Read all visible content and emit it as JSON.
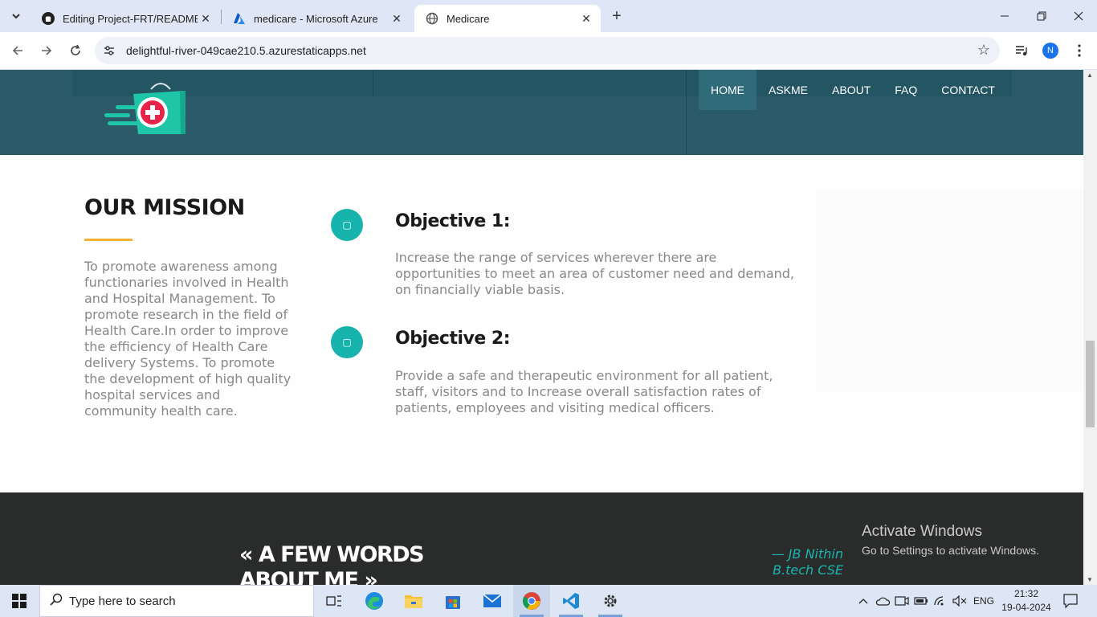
{
  "browser": {
    "tabs": [
      {
        "title": "Editing Project-FRT/README.m",
        "icon": "github-icon",
        "close": "✕"
      },
      {
        "title": "medicare - Microsoft Azure",
        "icon": "azure-icon",
        "close": "✕"
      },
      {
        "title": "Medicare",
        "icon": "globe-icon",
        "close": "✕",
        "active": true
      }
    ],
    "new_tab": "+",
    "url": "delightful-river-049cae210.5.azurestaticapps.net",
    "profile_initial": "N"
  },
  "page": {
    "nav": [
      "HOME",
      "ASKME",
      "ABOUT",
      "FAQ",
      "CONTACT"
    ],
    "mission": {
      "title": "OUR MISSION",
      "text": "To promote awareness among functionaries involved in Health and Hospital Management. To promote research in the field of Health Care.In order to improve the efficiency of Health Care delivery Systems. To promote the development of high quality hospital services and community health care."
    },
    "objectives": [
      {
        "title": "Objective 1:",
        "text": "Increase the range of services wherever there are opportunities to meet an area of customer need and demand, on financially viable basis."
      },
      {
        "title": "Objective 2:",
        "text": "Provide a safe and therapeutic environment for all patient, staff, visitors and to Increase overall satisfaction rates of patients, employees and visiting medical officers."
      }
    ],
    "quote": {
      "line1": "« A FEW WORDS",
      "line2": "ABOUT ME »",
      "author_line1": "— JB Nithin",
      "author_line2": "B.tech CSE"
    }
  },
  "watermark": {
    "line1": "Activate Windows",
    "line2": "Go to Settings to activate Windows."
  },
  "taskbar": {
    "search_placeholder": "Type here to search",
    "language": "ENG",
    "time": "21:32",
    "date": "19-04-2024"
  },
  "colors": {
    "header": "#2b5a68",
    "accent": "#17b3ad",
    "rule": "#f2b233",
    "footer": "#2a2c2b"
  }
}
